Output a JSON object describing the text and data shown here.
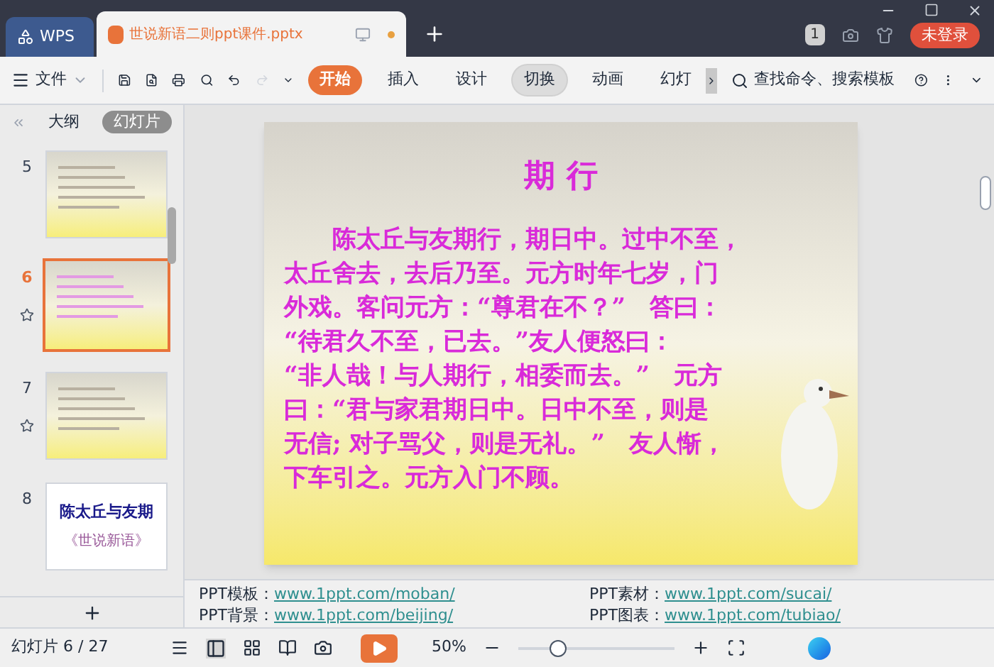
{
  "app_tab": {
    "label": "WPS"
  },
  "doc_tab": {
    "title": "世说新语二则ppt课件.pptx",
    "unsaved": true
  },
  "page_badge": "1",
  "login_button": "未登录",
  "file_menu": "文件",
  "ribbon_tabs": [
    {
      "label": "开始",
      "selected": true,
      "highlighted": false
    },
    {
      "label": "插入",
      "selected": false,
      "highlighted": false
    },
    {
      "label": "设计",
      "selected": false,
      "highlighted": false
    },
    {
      "label": "切换",
      "selected": false,
      "highlighted": true
    },
    {
      "label": "动画",
      "selected": false,
      "highlighted": false
    },
    {
      "label": "幻灯",
      "selected": false,
      "highlighted": false
    }
  ],
  "search": {
    "placeholder": "查找命令、搜索模板"
  },
  "panel_tabs": [
    {
      "label": "大纲",
      "selected": false
    },
    {
      "label": "幻灯片",
      "selected": true
    }
  ],
  "slides": [
    {
      "number": "5",
      "selected": false,
      "starred": false,
      "kind": "text"
    },
    {
      "number": "6",
      "selected": true,
      "starred": true,
      "kind": "pink"
    },
    {
      "number": "7",
      "selected": false,
      "starred": true,
      "kind": "text"
    },
    {
      "number": "8",
      "selected": false,
      "starred": false,
      "kind": "cover",
      "title": "陈太丘与友期",
      "subtitle": "《世说新语》"
    }
  ],
  "slide": {
    "title": "期 行",
    "lines": [
      "陈太丘与友期行，期日中。过中不至，",
      "太丘舍去，去后乃至。元方时年七岁，门",
      "外戏。客问元方：“尊君在不？”　答曰：",
      "“待君久不至，已去。”友人便怒曰：",
      "“非人哉！与人期行，相委而去。”　元方",
      "曰：“君与家君期日中。日中不至，则是",
      "无信; 对子骂父，则是无礼。”　友人惭，",
      "下车引之。元方入门不顾。"
    ]
  },
  "notes": [
    {
      "label": "PPT模板：",
      "link": "www.1ppt.com/moban/"
    },
    {
      "label": "PPT素材：",
      "link": "www.1ppt.com/sucai/"
    },
    {
      "label": "PPT背景：",
      "link": "www.1ppt.com/beijing/"
    },
    {
      "label": "PPT图表：",
      "link": "www.1ppt.com/tubiao/"
    }
  ],
  "status": {
    "slide_counter": "幻灯片 6 / 27",
    "zoom": "50%",
    "zoom_level": {
      "level": 0.25
    }
  }
}
